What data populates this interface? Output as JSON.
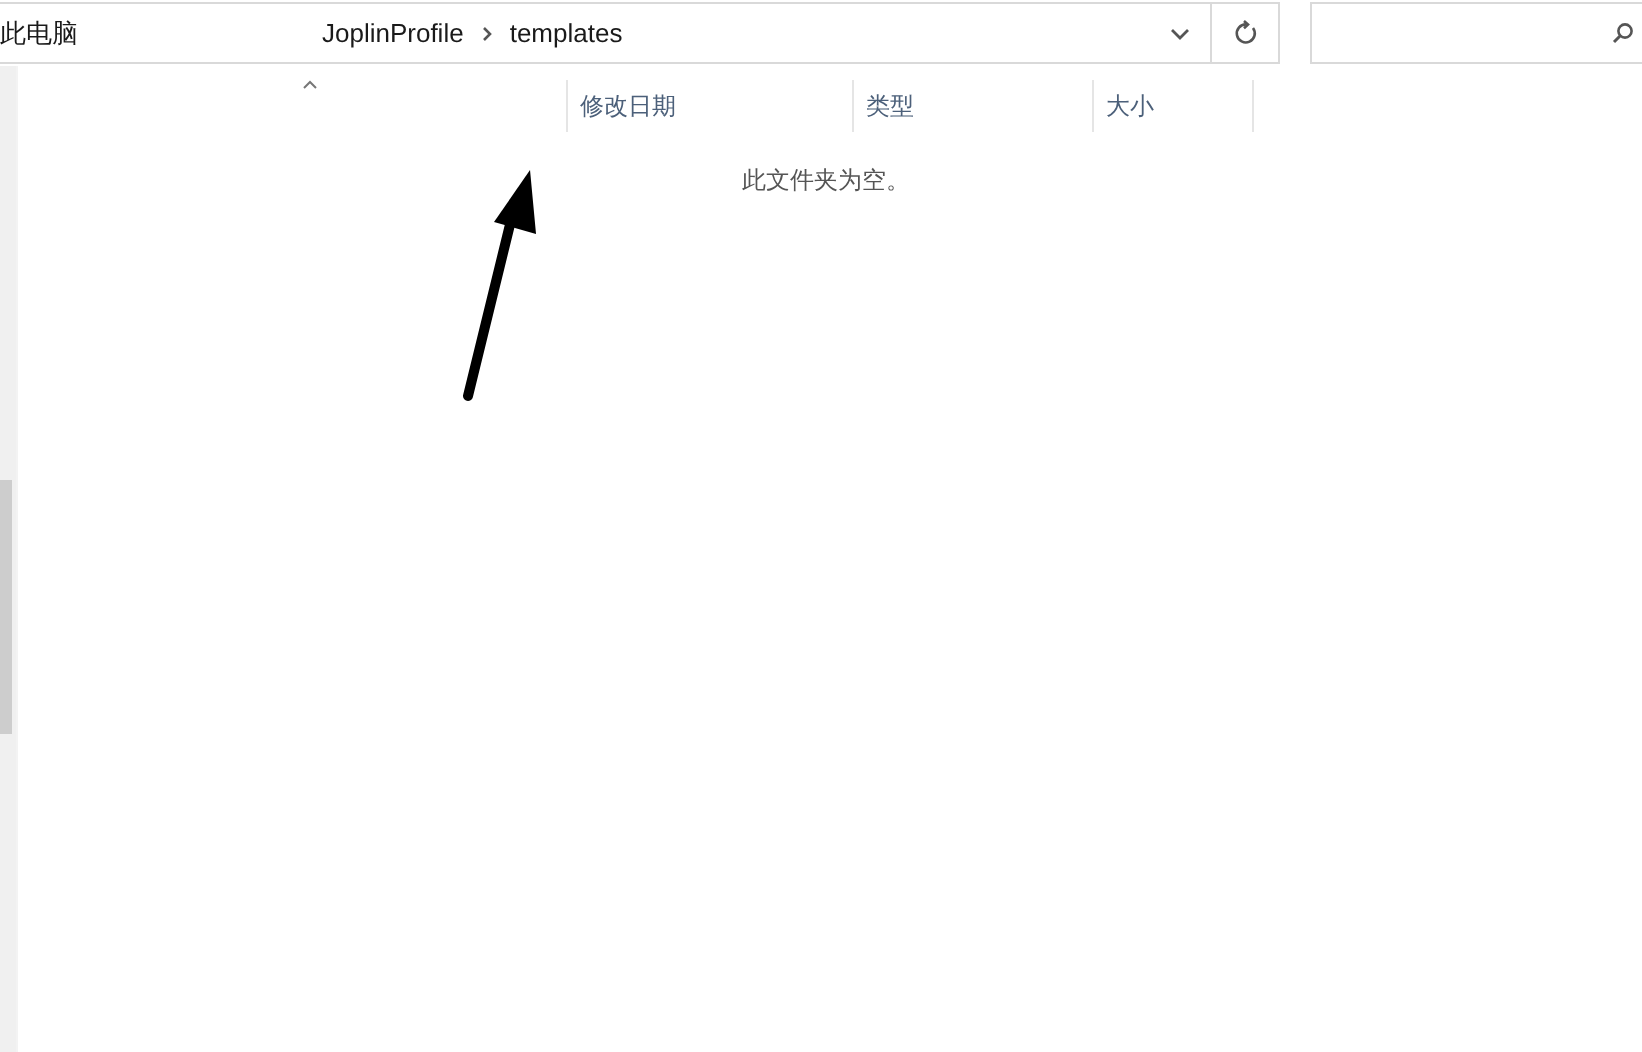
{
  "address_bar": {
    "breadcrumbs": [
      "此电脑",
      "JoplinProfile",
      "templates"
    ]
  },
  "columns": [
    {
      "label": "修改日期"
    },
    {
      "label": "类型"
    },
    {
      "label": "大小"
    }
  ],
  "empty_message": "此文件夹为空。"
}
